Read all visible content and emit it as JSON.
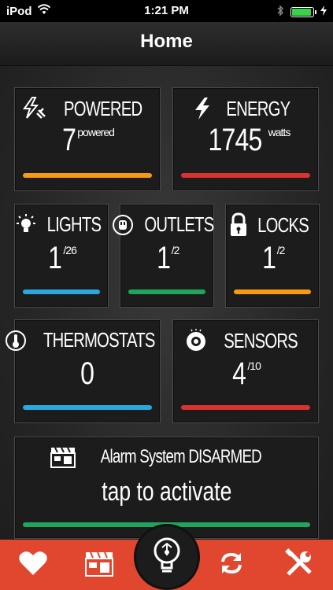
{
  "status_bar": {
    "carrier": "iPod",
    "time": "1:21 PM"
  },
  "nav": {
    "title": "Home"
  },
  "colors": {
    "orange": "#f59a12",
    "red": "#d8332f",
    "blue": "#2aa8dd",
    "green": "#1fa65c",
    "tabbar": "#e1472f"
  },
  "cards": {
    "powered": {
      "label": "POWERED",
      "value": "7",
      "suffix": "powered",
      "icon": "plug-lightning-icon"
    },
    "energy": {
      "label": "ENERGY",
      "value": "1745",
      "suffix": "watts",
      "icon": "lightning-icon"
    },
    "lights": {
      "label": "LIGHTS",
      "value": "1",
      "suffix": "/26",
      "icon": "lightbulb-icon"
    },
    "outlets": {
      "label": "OUTLETS",
      "value": "1",
      "suffix": "/2",
      "icon": "outlet-icon"
    },
    "locks": {
      "label": "LOCKS",
      "value": "1",
      "suffix": "/2",
      "icon": "padlock-icon"
    },
    "thermostats": {
      "label": "THERMOSTATS",
      "value": "0",
      "icon": "thermometer-icon"
    },
    "sensors": {
      "label": "SENSORS",
      "value": "4",
      "suffix": "/10",
      "icon": "sensor-icon"
    }
  },
  "alarm": {
    "status": "Alarm System DISARMED",
    "action": "tap to activate",
    "icon": "scene-clapper-icon"
  },
  "tabbar": {
    "items": [
      "heart-icon",
      "scenes-icon",
      "lightbulb-icon",
      "refresh-icon",
      "tools-icon"
    ]
  }
}
